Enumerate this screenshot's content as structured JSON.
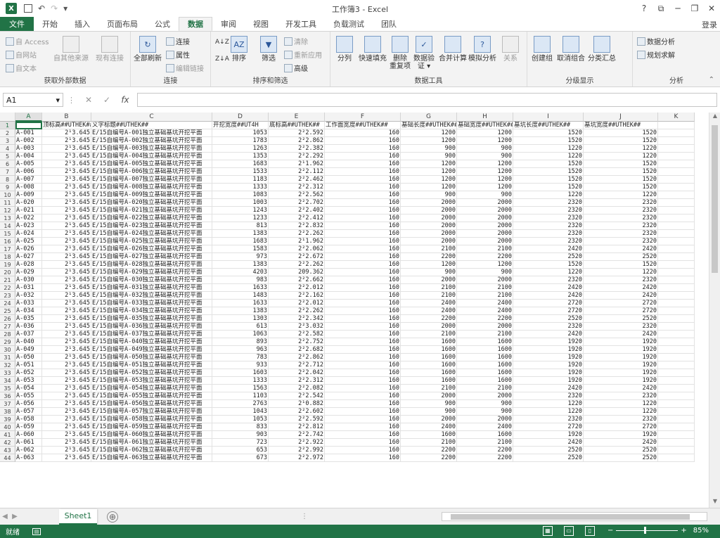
{
  "window": {
    "title": "工作簿3 - Excel",
    "help": "?",
    "minimize": "─",
    "restore": "❐",
    "close": "✕",
    "ribbon_display": "⧉"
  },
  "quick_access": {
    "save_icon": "save-icon",
    "undo": "↶",
    "redo": "↷",
    "customize": "▾"
  },
  "tabs": [
    {
      "label": "文件"
    },
    {
      "label": "开始"
    },
    {
      "label": "插入"
    },
    {
      "label": "页面布局"
    },
    {
      "label": "公式"
    },
    {
      "label": "数据"
    },
    {
      "label": "审阅"
    },
    {
      "label": "视图"
    },
    {
      "label": "开发工具"
    },
    {
      "label": "负载测试"
    },
    {
      "label": "团队"
    }
  ],
  "login": "登录",
  "ribbon": {
    "get_external": {
      "access": "自 Access",
      "web": "自网站",
      "text": "自文本",
      "other": "自其他来源",
      "existing": "现有连接",
      "label": "获取外部数据"
    },
    "connections": {
      "refresh_all": "全部刷新",
      "connections": "连接",
      "properties": "属性",
      "edit_links": "编辑链接",
      "label": "连接"
    },
    "sort_filter": {
      "az": "A↓Z",
      "za": "Z↓A",
      "sort": "排序",
      "filter": "筛选",
      "clear": "清除",
      "reapply": "重新应用",
      "advanced": "高级",
      "label": "排序和筛选"
    },
    "data_tools": {
      "split": "分列",
      "flash_fill": "快速填充",
      "remove_dup": "删除\n重复项",
      "validation": "数据验\n证 ▾",
      "consolidate": "合并计算",
      "whatif": "模拟分析",
      "relations": "关系",
      "label": "数据工具"
    },
    "outline": {
      "group": "创建组",
      "ungroup": "取消组合",
      "subtotal": "分类汇总",
      "label": "分级显示"
    },
    "analysis": {
      "data_analysis": "数据分析",
      "solver": "规划求解",
      "label": "分析"
    }
  },
  "formula_bar": {
    "name_box": "A1",
    "cancel": "✕",
    "enter": "✓",
    "fx": "fx",
    "value": ""
  },
  "columns": [
    "",
    "A",
    "B",
    "C",
    "D",
    "E",
    "F",
    "G",
    "H",
    "I",
    "J",
    "K"
  ],
  "rows": [
    {
      "n": "1",
      "cells": [
        "",
        "顶标高##UTHEK##",
        "义字标题##UTHEK##",
        "开挖宽度##UT4H",
        "底标高##UTHEK##",
        "工作面宽度##UTHEK##",
        "基础长度##UTHEK##",
        "基础宽度##UTHEK##",
        "基坑长度##UTHEK##",
        "基坑宽度##UTHEK##",
        ""
      ]
    },
    {
      "n": "2",
      "cells": [
        "A-001",
        "2¹3.645",
        "E/15自编号A-001独立基础基坑开挖平面",
        "1053",
        "2²2.592",
        "160",
        "1200",
        "1200",
        "1520",
        "1520",
        ""
      ]
    },
    {
      "n": "3",
      "cells": [
        "A-002",
        "2¹3.645",
        "E/15自编号A-002独立基础基坑开挖平面",
        "1783",
        "2²2.862",
        "160",
        "1200",
        "1200",
        "1520",
        "1520",
        ""
      ]
    },
    {
      "n": "4",
      "cells": [
        "A-003",
        "2¹3.645",
        "E/15自编号A-003独立基础基坑开挖平面",
        "1263",
        "2²2.382",
        "160",
        "900",
        "900",
        "1220",
        "1220",
        ""
      ]
    },
    {
      "n": "5",
      "cells": [
        "A-004",
        "2¹3.645",
        "E/15自编号A-004独立基础基坑开挖平面",
        "1353",
        "2²2.292",
        "160",
        "900",
        "900",
        "1220",
        "1220",
        ""
      ]
    },
    {
      "n": "6",
      "cells": [
        "A-005",
        "2¹3.645",
        "E/15自编号A-005独立基础基坑开挖平面",
        "1683",
        "2¹1.962",
        "160",
        "1200",
        "1200",
        "1520",
        "1520",
        ""
      ]
    },
    {
      "n": "7",
      "cells": [
        "A-006",
        "2¹3.645",
        "E/15自编号A-006独立基础基坑开挖平面",
        "1533",
        "2²2.112",
        "160",
        "1200",
        "1200",
        "1520",
        "1520",
        ""
      ]
    },
    {
      "n": "8",
      "cells": [
        "A-007",
        "2¹3.645",
        "E/15自编号A-007独立基础基坑开挖平面",
        "1183",
        "2²2.462",
        "160",
        "1200",
        "1200",
        "1520",
        "1520",
        ""
      ]
    },
    {
      "n": "9",
      "cells": [
        "A-008",
        "2¹3.645",
        "E/15自编号A-008独立基础基坑开挖平面",
        "1333",
        "2²2.312",
        "160",
        "1200",
        "1200",
        "1520",
        "1520",
        ""
      ]
    },
    {
      "n": "10",
      "cells": [
        "A-009",
        "2¹3.645",
        "E/15自编号A-009独立基础基坑开挖平面",
        "1083",
        "2²2.562",
        "160",
        "900",
        "900",
        "1220",
        "1220",
        ""
      ]
    },
    {
      "n": "11",
      "cells": [
        "A-020",
        "2¹3.645",
        "E/15自编号A-020独立基础基坑开挖平面",
        "1003",
        "2²2.702",
        "160",
        "2000",
        "2000",
        "2320",
        "2320",
        ""
      ]
    },
    {
      "n": "12",
      "cells": [
        "A-021",
        "2¹3.645",
        "E/15自编号A-021独立基础基坑开挖平面",
        "1243",
        "2²2.402",
        "160",
        "2000",
        "2000",
        "2320",
        "2320",
        ""
      ]
    },
    {
      "n": "13",
      "cells": [
        "A-022",
        "2¹3.645",
        "E/15自编号A-022独立基础基坑开挖平面",
        "1233",
        "2²2.412",
        "160",
        "2000",
        "2000",
        "2320",
        "2320",
        ""
      ]
    },
    {
      "n": "14",
      "cells": [
        "A-023",
        "2¹3.645",
        "E/15自编号A-023独立基础基坑开挖平面",
        "813",
        "2²2.832",
        "160",
        "2000",
        "2000",
        "2320",
        "2320",
        ""
      ]
    },
    {
      "n": "15",
      "cells": [
        "A-024",
        "2¹3.645",
        "E/15自编号A-024独立基础基坑开挖平面",
        "1383",
        "2²2.262",
        "160",
        "2000",
        "2000",
        "2320",
        "2320",
        ""
      ]
    },
    {
      "n": "16",
      "cells": [
        "A-025",
        "2¹3.645",
        "E/15自编号A-025独立基础基坑开挖平面",
        "1683",
        "2¹1.962",
        "160",
        "2000",
        "2000",
        "2320",
        "2320",
        ""
      ]
    },
    {
      "n": "17",
      "cells": [
        "A-026",
        "2¹3.645",
        "E/15自编号A-026独立基础基坑开挖平面",
        "1583",
        "2²2.062",
        "160",
        "2100",
        "2100",
        "2420",
        "2420",
        ""
      ]
    },
    {
      "n": "18",
      "cells": [
        "A-027",
        "2¹3.645",
        "E/15自编号A-027独立基础基坑开挖平面",
        "973",
        "2²2.672",
        "160",
        "2200",
        "2200",
        "2520",
        "2520",
        ""
      ]
    },
    {
      "n": "19",
      "cells": [
        "A-028",
        "2¹3.645",
        "E/15自编号A-028独立基础基坑开挖平面",
        "1383",
        "2²2.262",
        "160",
        "1200",
        "1200",
        "1520",
        "1520",
        ""
      ]
    },
    {
      "n": "20",
      "cells": [
        "A-029",
        "2¹3.645",
        "E/15自编号A-029独立基础基坑开挖平面",
        "4203",
        "209.362",
        "160",
        "900",
        "900",
        "1220",
        "1220",
        ""
      ]
    },
    {
      "n": "21",
      "cells": [
        "A-030",
        "2¹3.645",
        "E/15自编号A-030独立基础基坑开挖平面",
        "983",
        "2²2.662",
        "160",
        "2000",
        "2000",
        "2320",
        "2320",
        ""
      ]
    },
    {
      "n": "22",
      "cells": [
        "A-031",
        "2¹3.645",
        "E/15自编号A-031独立基础基坑开挖平面",
        "1633",
        "2²2.012",
        "160",
        "2100",
        "2100",
        "2420",
        "2420",
        ""
      ]
    },
    {
      "n": "23",
      "cells": [
        "A-032",
        "2¹3.645",
        "E/15自编号A-032独立基础基坑开挖平面",
        "1483",
        "2²2.162",
        "160",
        "2100",
        "2100",
        "2420",
        "2420",
        ""
      ]
    },
    {
      "n": "24",
      "cells": [
        "A-033",
        "2¹3.645",
        "E/15自编号A-033独立基础基坑开挖平面",
        "1633",
        "2²2.012",
        "160",
        "2400",
        "2400",
        "2720",
        "2720",
        ""
      ]
    },
    {
      "n": "25",
      "cells": [
        "A-034",
        "2¹3.645",
        "E/15自编号A-034独立基础基坑开挖平面",
        "1383",
        "2²2.262",
        "160",
        "2400",
        "2400",
        "2720",
        "2720",
        ""
      ]
    },
    {
      "n": "26",
      "cells": [
        "A-035",
        "2¹3.645",
        "E/15自编号A-035独立基础基坑开挖平面",
        "1303",
        "2²2.342",
        "160",
        "2200",
        "2200",
        "2520",
        "2520",
        ""
      ]
    },
    {
      "n": "27",
      "cells": [
        "A-036",
        "2¹3.645",
        "E/15自编号A-036独立基础基坑开挖平面",
        "613",
        "2²3.032",
        "160",
        "2000",
        "2000",
        "2320",
        "2320",
        ""
      ]
    },
    {
      "n": "28",
      "cells": [
        "A-037",
        "2¹3.645",
        "E/15自编号A-037独立基础基坑开挖平面",
        "1063",
        "2²2.582",
        "160",
        "2100",
        "2100",
        "2420",
        "2420",
        ""
      ]
    },
    {
      "n": "29",
      "cells": [
        "A-040",
        "2¹3.645",
        "E/15自编号A-040独立基础基坑开挖平面",
        "893",
        "2²2.752",
        "160",
        "1600",
        "1600",
        "1920",
        "1920",
        ""
      ]
    },
    {
      "n": "30",
      "cells": [
        "A-049",
        "2¹3.645",
        "E/15自编号A-049独立基础基坑开挖平面",
        "963",
        "2²2.682",
        "160",
        "1600",
        "1600",
        "1920",
        "1920",
        ""
      ]
    },
    {
      "n": "31",
      "cells": [
        "A-050",
        "2¹3.645",
        "E/15自编号A-050独立基础基坑开挖平面",
        "783",
        "2²2.862",
        "160",
        "1600",
        "1600",
        "1920",
        "1920",
        ""
      ]
    },
    {
      "n": "32",
      "cells": [
        "A-051",
        "2¹3.645",
        "E/15自编号A-051独立基础基坑开挖平面",
        "933",
        "2²2.712",
        "160",
        "1600",
        "1600",
        "1920",
        "1920",
        ""
      ]
    },
    {
      "n": "33",
      "cells": [
        "A-052",
        "2¹3.645",
        "E/15自编号A-052独立基础基坑开挖平面",
        "1603",
        "2²2.042",
        "160",
        "1600",
        "1600",
        "1920",
        "1920",
        ""
      ]
    },
    {
      "n": "34",
      "cells": [
        "A-053",
        "2¹3.645",
        "E/15自编号A-053独立基础基坑开挖平面",
        "1333",
        "2²2.312",
        "160",
        "1600",
        "1600",
        "1920",
        "1920",
        ""
      ]
    },
    {
      "n": "35",
      "cells": [
        "A-054",
        "2¹3.645",
        "E/15自编号A-054独立基础基坑开挖平面",
        "1563",
        "2²2.082",
        "160",
        "2100",
        "2100",
        "2420",
        "2420",
        ""
      ]
    },
    {
      "n": "36",
      "cells": [
        "A-055",
        "2¹3.645",
        "E/15自编号A-055独立基础基坑开挖平面",
        "1103",
        "2²2.542",
        "160",
        "2000",
        "2000",
        "2320",
        "2320",
        ""
      ]
    },
    {
      "n": "37",
      "cells": [
        "A-056",
        "2¹3.645",
        "E/15自编号A-056独立基础基坑开挖平面",
        "2763",
        "2¹0.882",
        "160",
        "900",
        "900",
        "1220",
        "1220",
        ""
      ]
    },
    {
      "n": "38",
      "cells": [
        "A-057",
        "2¹3.645",
        "E/15自编号A-057独立基础基坑开挖平面",
        "1043",
        "2²2.602",
        "160",
        "900",
        "900",
        "1220",
        "1220",
        ""
      ]
    },
    {
      "n": "39",
      "cells": [
        "A-058",
        "2¹3.645",
        "E/15自编号A-058独立基础基坑开挖平面",
        "1053",
        "2²2.592",
        "160",
        "2000",
        "2000",
        "2320",
        "2320",
        ""
      ]
    },
    {
      "n": "40",
      "cells": [
        "A-059",
        "2¹3.645",
        "E/15自编号A-059独立基础基坑开挖平面",
        "833",
        "2²2.812",
        "160",
        "2400",
        "2400",
        "2720",
        "2720",
        ""
      ]
    },
    {
      "n": "41",
      "cells": [
        "A-060",
        "2¹3.645",
        "E/15自编号A-060独立基础基坑开挖平面",
        "903",
        "2²2.742",
        "160",
        "1600",
        "1600",
        "1920",
        "1920",
        ""
      ]
    },
    {
      "n": "42",
      "cells": [
        "A-061",
        "2¹3.645",
        "E/15自编号A-061独立基础基坑开挖平面",
        "723",
        "2²2.922",
        "160",
        "2100",
        "2100",
        "2420",
        "2420",
        ""
      ]
    },
    {
      "n": "43",
      "cells": [
        "A-062",
        "2¹3.645",
        "E/15自编号A-062独立基础基坑开挖平面",
        "653",
        "2²2.992",
        "160",
        "2200",
        "2200",
        "2520",
        "2520",
        ""
      ]
    },
    {
      "n": "44",
      "cells": [
        "A-063",
        "2¹3.645",
        "E/15自编号A-063独立基础基坑开挖平面",
        "673",
        "2²2.972",
        "160",
        "2200",
        "2200",
        "2520",
        "2520",
        ""
      ]
    }
  ],
  "sheets": [
    {
      "label": "Sheet1"
    }
  ],
  "add_sheet": "⊕",
  "status": {
    "ready": "就绪",
    "zoom": "85%",
    "zoom_minus": "−",
    "zoom_plus": "+"
  }
}
